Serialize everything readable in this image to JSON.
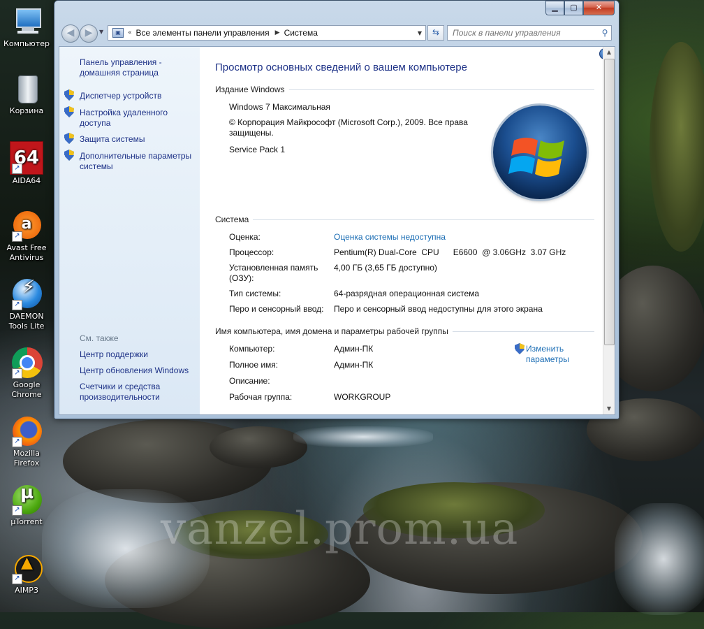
{
  "desktop": {
    "icons": [
      {
        "label": "Компьютер"
      },
      {
        "label": "Корзина"
      },
      {
        "label": "AIDA64",
        "glyph": "64"
      },
      {
        "label": "Avast Free\nAntivirus",
        "line1": "Avast Free",
        "line2": "Antivirus"
      },
      {
        "label": "DAEMON Tools Lite",
        "line1": "DAEMON",
        "line2": "Tools Lite"
      },
      {
        "label": "Google Chrome",
        "line1": "Google",
        "line2": "Chrome"
      },
      {
        "label": "Mozilla Firefox",
        "line1": "Mozilla",
        "line2": "Firefox"
      },
      {
        "label": "µTorrent"
      },
      {
        "label": "AIMP3"
      }
    ],
    "watermark": "vanzel.prom.ua"
  },
  "window": {
    "nav": {
      "address_root": "Все элементы панели управления",
      "address_current": "Система",
      "search_placeholder": "Поиск в панели управления"
    },
    "sidebar": {
      "home_link": "Панель управления - домашняя страница",
      "tasks": [
        {
          "label": "Диспетчер устройств"
        },
        {
          "label": "Настройка удаленного доступа"
        },
        {
          "label": "Защита системы"
        },
        {
          "label": "Дополнительные параметры системы"
        }
      ],
      "see_also_label": "См. также",
      "see_also": [
        {
          "label": "Центр поддержки"
        },
        {
          "label": "Центр обновления Windows"
        },
        {
          "label": "Счетчики и средства производительности"
        }
      ]
    },
    "main": {
      "title": "Просмотр основных сведений о вашем компьютере",
      "edition": {
        "header": "Издание Windows",
        "name": "Windows 7 Максимальная",
        "copyright": "© Корпорация Майкрософт (Microsoft Corp.), 2009. Все права защищены.",
        "service_pack": "Service Pack 1"
      },
      "system": {
        "header": "Система",
        "rows": [
          {
            "label": "Оценка:",
            "value": "Оценка системы недоступна"
          },
          {
            "label": "Процессор:",
            "value": "Pentium(R) Dual-Core  CPU      E6600  @ 3.06GHz  3.07 GHz"
          },
          {
            "label": "Установленная память (ОЗУ):",
            "value": "4,00 ГБ (3,65 ГБ доступно)"
          },
          {
            "label": "Тип системы:",
            "value": "64-разрядная операционная система"
          },
          {
            "label": "Перо и сенсорный ввод:",
            "value": "Перо и сенсорный ввод недоступны для этого экрана"
          }
        ]
      },
      "computer": {
        "header": "Имя компьютера, имя домена и параметры рабочей группы",
        "change_link": "Изменить параметры",
        "rows": [
          {
            "label": "Компьютер:",
            "value": "Админ-ПК"
          },
          {
            "label": "Полное имя:",
            "value": "Админ-ПК"
          },
          {
            "label": "Описание:",
            "value": ""
          },
          {
            "label": "Рабочая группа:",
            "value": "WORKGROUP"
          }
        ]
      }
    }
  }
}
